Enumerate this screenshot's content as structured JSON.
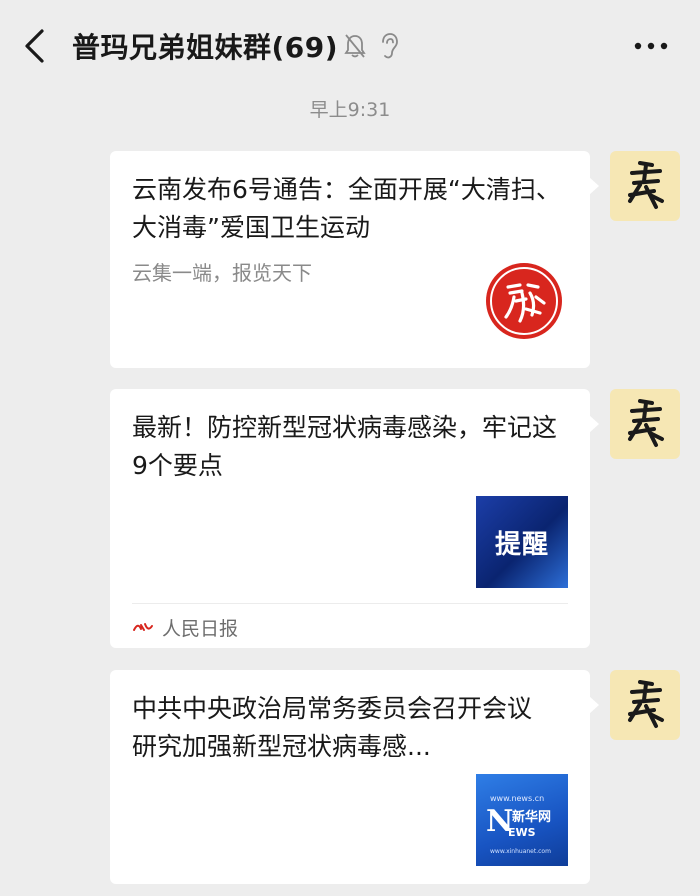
{
  "header": {
    "title": "普玛兄弟姐妹群(69)",
    "icons": [
      "back-arrow-icon",
      "mute-bell-icon",
      "ear-icon",
      "more-icon"
    ]
  },
  "timestamp": "早上9:31",
  "messages": [
    {
      "title": "云南发布6号通告：全面开展“大清扫、大消毒”爱国卫生运动",
      "description": "云集一端，报览天下",
      "thumbnail_icon": "red-seal-logo-icon",
      "sender_avatar": "calligraphy-avatar-icon"
    },
    {
      "title": "最新！防控新型冠状病毒感染，牢记这9个要点",
      "thumbnail_text": "提醒",
      "source_name": "人民日报",
      "source_icon": "peoples-daily-logo-icon",
      "sender_avatar": "calligraphy-avatar-icon"
    },
    {
      "title": "中共中央政治局常务委员会召开会议 研究加强新型冠状病毒感...",
      "thumbnail": {
        "top": "www.news.cn",
        "brand_letter": "N",
        "brand_cn": "新华网",
        "brand_word": "EWS",
        "url": "www.xinhuanet.com"
      },
      "sender_avatar": "calligraphy-avatar-icon"
    }
  ],
  "colors": {
    "background": "#ededed",
    "card": "#ffffff",
    "avatar_bg": "#f6e7b4",
    "seal_red": "#d8261e"
  }
}
